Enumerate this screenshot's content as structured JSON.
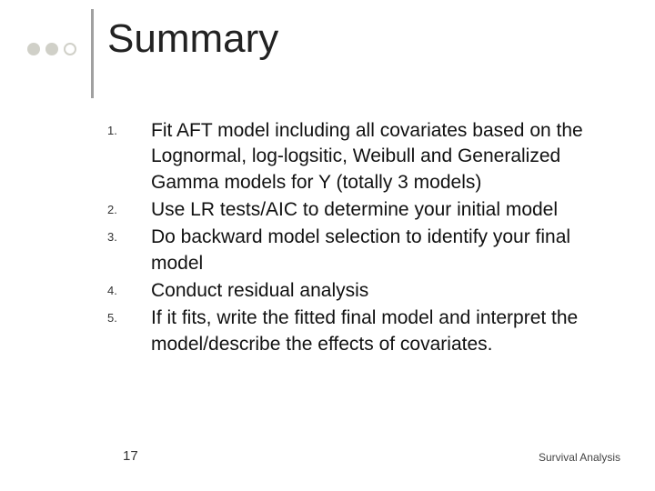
{
  "title": "Summary",
  "items": [
    {
      "num": "1.",
      "text": "Fit AFT model including all covariates based on the Lognormal, log-logsitic, Weibull and Generalized Gamma models for Y (totally 3 models)"
    },
    {
      "num": "2.",
      "text": "Use LR tests/AIC to determine your initial model"
    },
    {
      "num": "3.",
      "text": "Do backward model selection to identify your final model"
    },
    {
      "num": "4.",
      "text": "Conduct residual analysis"
    },
    {
      "num": "5.",
      "text": "If it fits, write the fitted final model and interpret the model/describe the effects of covariates."
    }
  ],
  "page_number": "17",
  "footer": "Survival Analysis"
}
